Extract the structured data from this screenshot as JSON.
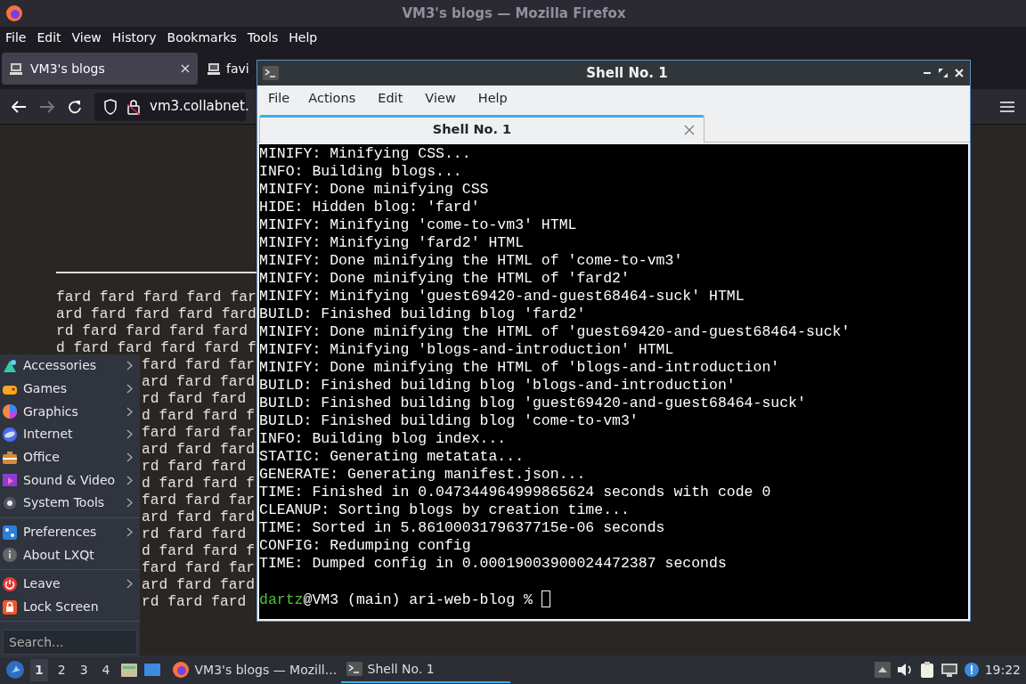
{
  "firefox": {
    "title": "VM3's blogs — Mozilla Firefox",
    "menu": [
      "File",
      "Edit",
      "View",
      "History",
      "Bookmarks",
      "Tools",
      "Help"
    ],
    "tabs": [
      {
        "label": "VM3's blogs",
        "selected": true,
        "closable": true
      },
      {
        "label": "favi",
        "selected": false,
        "closable": false
      }
    ],
    "url": "vm3.collabnet.",
    "lines_top": [
      "fard fard fard fard far",
      "ard fard fard fard fard",
      "rd fard fard fard fard",
      "d fard fard fard fard f"
    ],
    "lines_beside_menu": [
      "fard fard far",
      "ard fard fard",
      "rd fard fard",
      "d fard fard f",
      "fard fard far",
      "ard fard fard",
      "rd fard fard",
      "d fard fard f",
      "fard fard far",
      "ard fard fard",
      "rd fard fard",
      "d fard fard f",
      "fard fard far",
      "ard fard fard",
      "rd fard fard"
    ]
  },
  "terminal": {
    "title": "Shell No. 1",
    "menu": [
      "File",
      "Actions",
      "Edit",
      "View",
      "Help"
    ],
    "tabs": [
      {
        "label": "Shell No. 1",
        "selected": true
      }
    ],
    "output": [
      "MINIFY: Minifying CSS...",
      "INFO: Building blogs...",
      "MINIFY: Done minifying CSS",
      "HIDE: Hidden blog: 'fard'",
      "MINIFY: Minifying 'come-to-vm3' HTML",
      "MINIFY: Minifying 'fard2' HTML",
      "MINIFY: Done minifying the HTML of 'come-to-vm3'",
      "MINIFY: Done minifying the HTML of 'fard2'",
      "MINIFY: Minifying 'guest69420-and-guest68464-suck' HTML",
      "BUILD: Finished building blog 'fard2'",
      "MINIFY: Done minifying the HTML of 'guest69420-and-guest68464-suck'",
      "MINIFY: Minifying 'blogs-and-introduction' HTML",
      "MINIFY: Done minifying the HTML of 'blogs-and-introduction'",
      "BUILD: Finished building blog 'blogs-and-introduction'",
      "BUILD: Finished building blog 'guest69420-and-guest68464-suck'",
      "BUILD: Finished building blog 'come-to-vm3'",
      "INFO: Building blog index...",
      "STATIC: Generating metatata...",
      "GENERATE: Generating manifest.json...",
      "TIME: Finished in 0.047344964999865624 seconds with code 0",
      "CLEANUP: Sorting blogs by creation time...",
      "TIME: Sorted in 5.8610003179637715e-06 seconds",
      "CONFIG: Redumping config",
      "TIME: Dumped config in 0.00019003900024472387 seconds"
    ],
    "prompt": {
      "user": "dartz",
      "rest": "@VM3 (main) ari-web-blog % "
    }
  },
  "app_menu": {
    "groups": [
      [
        {
          "label": "Accessories",
          "submenu": true
        },
        {
          "label": "Games",
          "submenu": true
        },
        {
          "label": "Graphics",
          "submenu": true
        },
        {
          "label": "Internet",
          "submenu": true
        },
        {
          "label": "Office",
          "submenu": true
        },
        {
          "label": "Sound & Video",
          "submenu": true
        },
        {
          "label": "System Tools",
          "submenu": true
        }
      ],
      [
        {
          "label": "Preferences",
          "submenu": true
        },
        {
          "label": "About LXQt",
          "submenu": false
        }
      ],
      [
        {
          "label": "Leave",
          "submenu": true
        },
        {
          "label": "Lock Screen",
          "submenu": false
        }
      ]
    ],
    "search_placeholder": "Search..."
  },
  "taskbar": {
    "desktops": [
      {
        "label": "1",
        "selected": true
      },
      {
        "label": "2",
        "selected": false
      },
      {
        "label": "3",
        "selected": false
      },
      {
        "label": "4",
        "selected": false
      }
    ],
    "tasks": [
      {
        "label": "VM3's blogs — Mozill...",
        "selected": false,
        "kind": "browser"
      },
      {
        "label": "Shell No. 1",
        "selected": true,
        "kind": "terminal"
      }
    ],
    "clock": "19:22"
  }
}
